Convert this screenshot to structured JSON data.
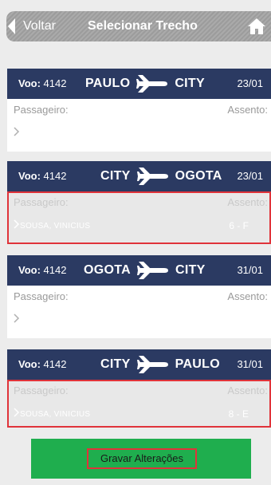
{
  "nav": {
    "back_label": "Voltar",
    "title": "Selecionar Trecho",
    "home_icon": "home-icon"
  },
  "segments": [
    {
      "flight_label": "Voo:",
      "flight_number": "4142",
      "origin": "PAULO",
      "destination": "CITY",
      "date": "23/01",
      "passenger_label": "Passageiro:",
      "seat_label": "Assento:",
      "passenger_name": "",
      "seat": "",
      "selected": false
    },
    {
      "flight_label": "Voo:",
      "flight_number": "4142",
      "origin": "CITY",
      "destination": "OGOTA",
      "date": "23/01",
      "passenger_label": "Passageiro:",
      "seat_label": "Assento:",
      "passenger_name": "SOUSA, VINICIUS",
      "seat": "6 - F",
      "selected": true
    },
    {
      "flight_label": "Voo:",
      "flight_number": "4142",
      "origin": "OGOTA",
      "destination": "CITY",
      "date": "31/01",
      "passenger_label": "Passageiro:",
      "seat_label": "Assento:",
      "passenger_name": "",
      "seat": "",
      "selected": false
    },
    {
      "flight_label": "Voo:",
      "flight_number": "4142",
      "origin": "CITY",
      "destination": "PAULO",
      "date": "31/01",
      "passenger_label": "Passageiro:",
      "seat_label": "Assento:",
      "passenger_name": "SOUSA, VINICIUS",
      "seat": "8 - E",
      "selected": true
    }
  ],
  "save_button": {
    "label": "Gravar Alterações"
  },
  "colors": {
    "header_bg": "#2b3a62",
    "nav_bg": "#a3a3a3",
    "button_green": "#1fae4e",
    "highlight_red": "#e0333a"
  },
  "icons": {
    "plane": "plane-icon",
    "chevron": "chevron-right-icon"
  }
}
